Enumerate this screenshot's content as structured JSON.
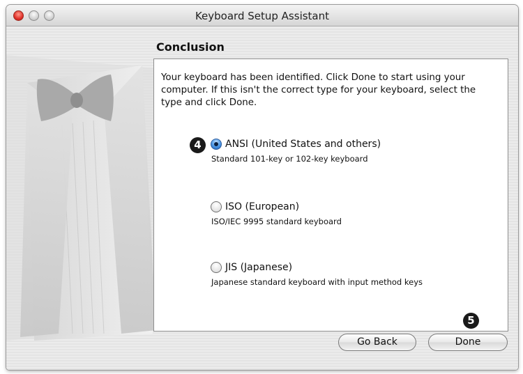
{
  "window": {
    "title": "Keyboard Setup Assistant"
  },
  "page": {
    "heading": "Conclusion",
    "intro": "Your keyboard has been identified. Click Done to start using your computer. If this isn't the correct type for your keyboard, select the type and click Done."
  },
  "options": [
    {
      "label": "ANSI (United States and others)",
      "description": "Standard 101-key or 102-key keyboard",
      "selected": true
    },
    {
      "label": "ISO (European)",
      "description": "ISO/IEC 9995 standard keyboard",
      "selected": false
    },
    {
      "label": "JIS (Japanese)",
      "description": "Japanese standard keyboard with input method keys",
      "selected": false
    }
  ],
  "callouts": {
    "first": "4",
    "second": "5"
  },
  "buttons": {
    "go_back": "Go Back",
    "done": "Done"
  }
}
